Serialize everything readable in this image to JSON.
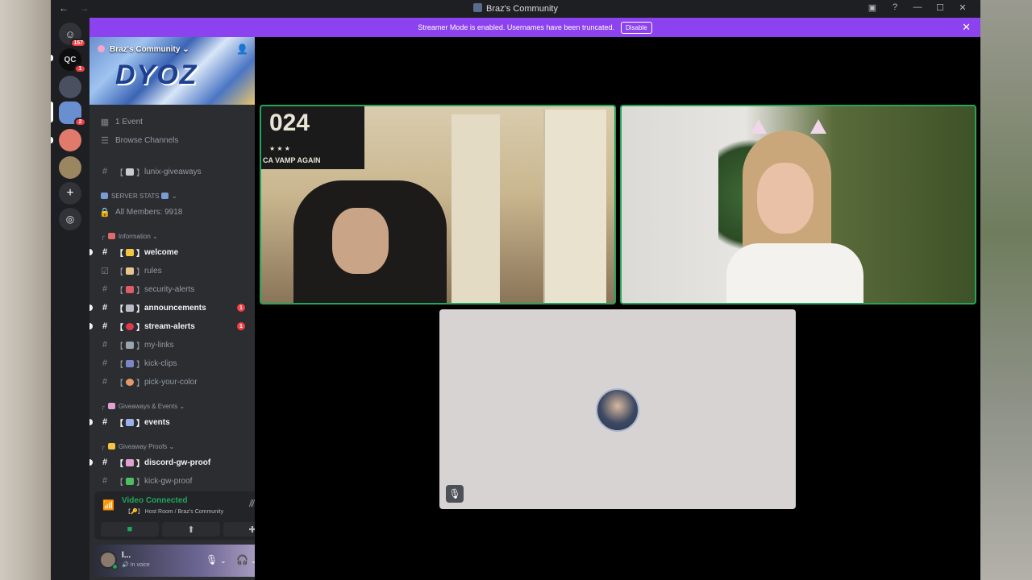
{
  "titlebar": {
    "title": "Braz's Community",
    "back_icon": "←",
    "forward_icon": "→",
    "inbox_icon": "inbox",
    "help_icon": "?",
    "minimize": "—",
    "maximize": "☐",
    "close": "✕"
  },
  "rail": {
    "home_badge": "157",
    "server2_badge": "1",
    "active_server_badge": "2"
  },
  "streamer_bar": {
    "message": "Streamer Mode is enabled. Usernames have been truncated.",
    "disable_label": "Disable",
    "bg_color": "#8d42ef"
  },
  "server": {
    "name": "Braz's Community",
    "banner_text": "DYOZ"
  },
  "sidebar": {
    "events_label": "1 Event",
    "browse_label": "Browse Channels",
    "lunix": "lunix-giveaways",
    "server_stats_label": "SERVER STATS",
    "all_members": "All Members: 9918",
    "cat_information": "Information",
    "welcome": "welcome",
    "rules": "rules",
    "security_alerts": "security-alerts",
    "announcements": "announcements",
    "announcements_count": "1",
    "stream_alerts": "stream-alerts",
    "stream_alerts_count": "1",
    "my_links": "my-links",
    "kick_clips": "kick-clips",
    "pick_your_color": "pick-your-color",
    "cat_giveaways": "Giveaways & Events",
    "events": "events",
    "cat_proofs": "Giveaway Proofs",
    "discord_gw_proof": "discord-gw-proof",
    "kick_gw_proof": "kick-gw-proof"
  },
  "voice": {
    "status": "Video Connected",
    "location": "Host Room / Braz's Community"
  },
  "user": {
    "name": "l...",
    "status": "In voice"
  },
  "colors": {
    "speaking_border": "#23a55a",
    "unread_badge": "#f23f43",
    "accent_purple": "#8d42ef"
  }
}
